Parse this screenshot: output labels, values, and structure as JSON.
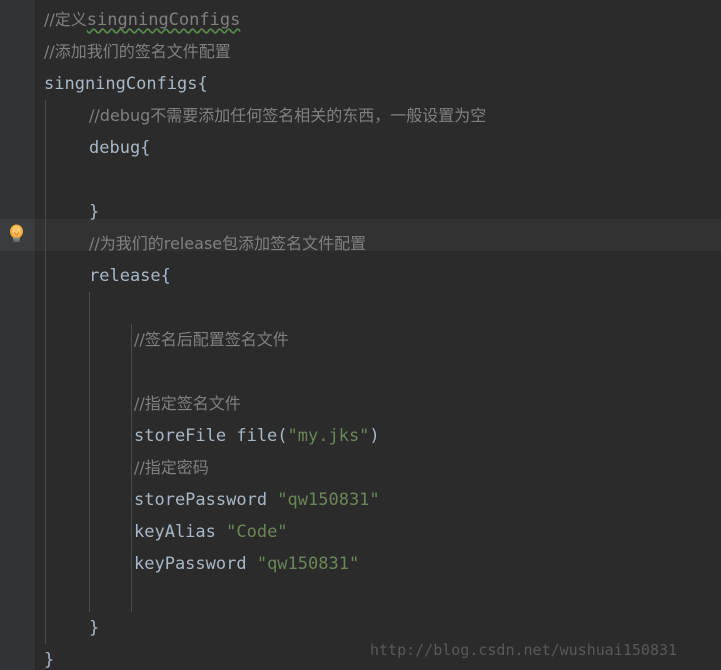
{
  "editor": {
    "theme_name": "darcula",
    "background_color": "#2b2b2b",
    "gutter_color": "#313335",
    "current_line_highlight_color": "#323232",
    "comment_color": "#808080",
    "string_color": "#6a8759",
    "identifier_color": "#a9b7c6",
    "watermark_color": "#595959"
  },
  "gutter": {
    "intention_bulb_tooltip": "Show intention actions",
    "bulb_color": "#f5ab35"
  },
  "code": {
    "lines": [
      {
        "indent": 0,
        "segments": [
          {
            "type": "comment",
            "text": "//定义"
          },
          {
            "type": "comment-typo",
            "text": "singningConfigs"
          }
        ]
      },
      {
        "indent": 0,
        "segments": [
          {
            "type": "comment",
            "text": "//添加我们的签名文件配置"
          }
        ]
      },
      {
        "indent": 0,
        "segments": [
          {
            "type": "code",
            "text": "singningConfigs{"
          }
        ]
      },
      {
        "indent": 1,
        "segments": [
          {
            "type": "comment",
            "text": "//debug不需要添加任何签名相关的东西，一般设置为空"
          }
        ]
      },
      {
        "indent": 1,
        "segments": [
          {
            "type": "code",
            "text": "debug{"
          }
        ]
      },
      {
        "indent": 1,
        "segments": []
      },
      {
        "indent": 1,
        "segments": [
          {
            "type": "code",
            "text": "}"
          }
        ]
      },
      {
        "indent": 1,
        "highlighted": true,
        "segments": [
          {
            "type": "comment",
            "text": "//为我们的release包添加签名文件配置"
          }
        ]
      },
      {
        "indent": 1,
        "segments": [
          {
            "type": "code",
            "text": "release{"
          }
        ]
      },
      {
        "indent": 1,
        "segments": []
      },
      {
        "indent": 2,
        "segments": [
          {
            "type": "comment",
            "text": "//签名后配置签名文件"
          }
        ]
      },
      {
        "indent": 2,
        "segments": []
      },
      {
        "indent": 2,
        "segments": [
          {
            "type": "comment",
            "text": "//指定签名文件"
          }
        ]
      },
      {
        "indent": 2,
        "segments": [
          {
            "type": "code",
            "text": "storeFile file("
          },
          {
            "type": "string",
            "text": "\"my.jks\""
          },
          {
            "type": "code",
            "text": ")"
          }
        ]
      },
      {
        "indent": 2,
        "segments": [
          {
            "type": "comment",
            "text": "//指定密码"
          }
        ]
      },
      {
        "indent": 2,
        "segments": [
          {
            "type": "code",
            "text": "storePassword "
          },
          {
            "type": "string",
            "text": "\"qw150831\""
          }
        ]
      },
      {
        "indent": 2,
        "segments": [
          {
            "type": "code",
            "text": "keyAlias "
          },
          {
            "type": "string",
            "text": "\"Code\""
          }
        ]
      },
      {
        "indent": 2,
        "segments": [
          {
            "type": "code",
            "text": "keyPassword "
          },
          {
            "type": "string",
            "text": "\"qw150831\""
          }
        ]
      },
      {
        "indent": 2,
        "segments": []
      },
      {
        "indent": 1,
        "segments": [
          {
            "type": "code",
            "text": "}"
          }
        ]
      },
      {
        "indent": 0,
        "segments": [
          {
            "type": "code",
            "text": "}"
          }
        ]
      }
    ]
  },
  "watermark": {
    "text": "http://blog.csdn.net/wushuai150831"
  }
}
